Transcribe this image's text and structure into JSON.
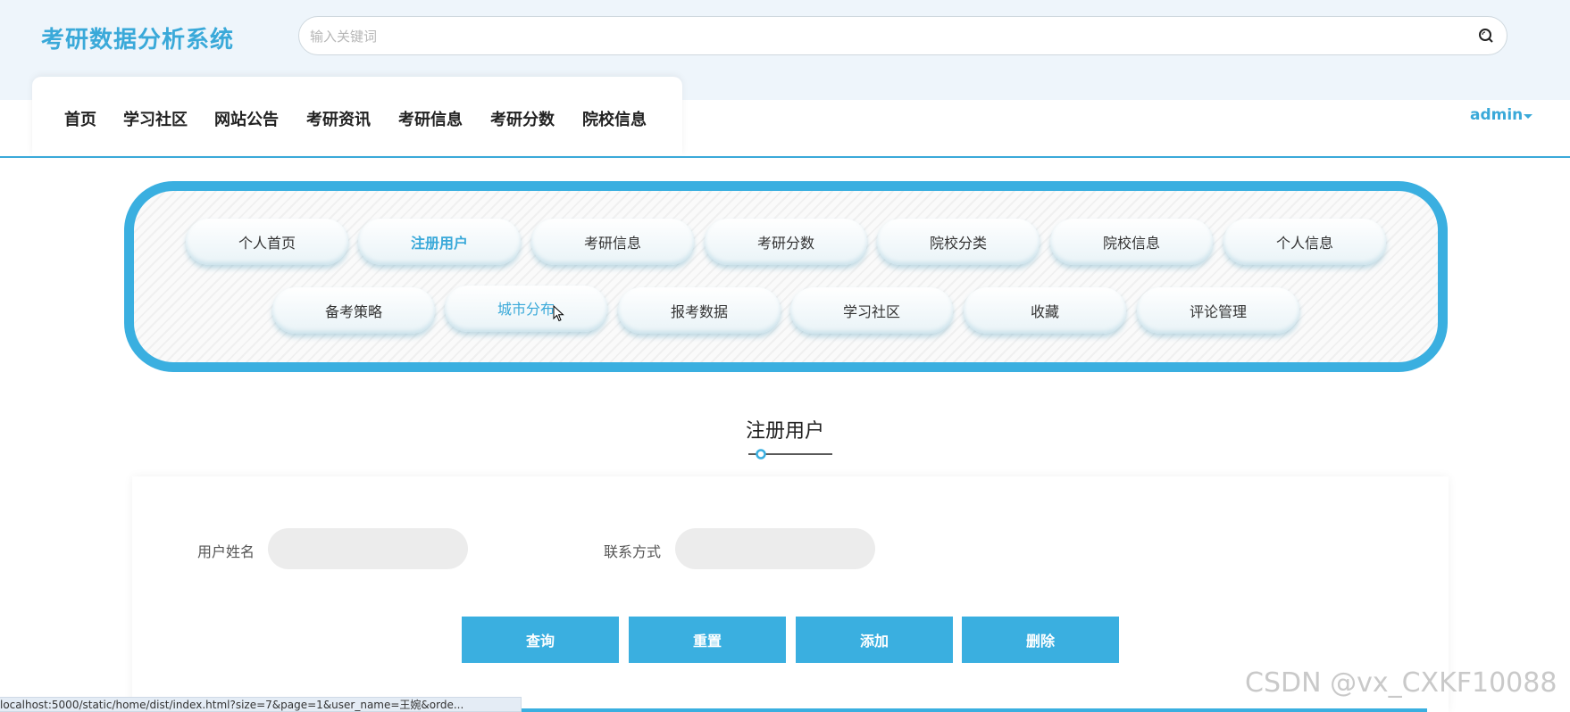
{
  "header": {
    "logo": "考研数据分析系统",
    "search_placeholder": "输入关键词",
    "search_value": "",
    "search_icon": "search-icon"
  },
  "nav": {
    "items": [
      "首页",
      "学习社区",
      "网站公告",
      "考研资讯",
      "考研信息",
      "考研分数",
      "院校信息"
    ],
    "user": "admin"
  },
  "side_menu": {
    "row1": [
      "个人首页",
      "注册用户",
      "考研信息",
      "考研分数",
      "院校分类",
      "院校信息",
      "个人信息"
    ],
    "row2": [
      "备考策略",
      "城市分布",
      "报考数据",
      "学习社区",
      "收藏",
      "评论管理"
    ],
    "active": "注册用户",
    "hovered": "城市分布"
  },
  "page": {
    "title": "注册用户"
  },
  "filters": {
    "username_label": "用户姓名",
    "username_value": "",
    "contact_label": "联系方式",
    "contact_value": ""
  },
  "actions": {
    "query": "查询",
    "reset": "重置",
    "add": "添加",
    "delete": "删除"
  },
  "status_bar": "localhost:5000/static/home/dist/index.html?size=7&page=1&user_name=王婉&orde...",
  "watermark": "CSDN @vx_CXKF10088",
  "colors": {
    "accent": "#3aafe0",
    "header_bg": "#eef5fb"
  }
}
